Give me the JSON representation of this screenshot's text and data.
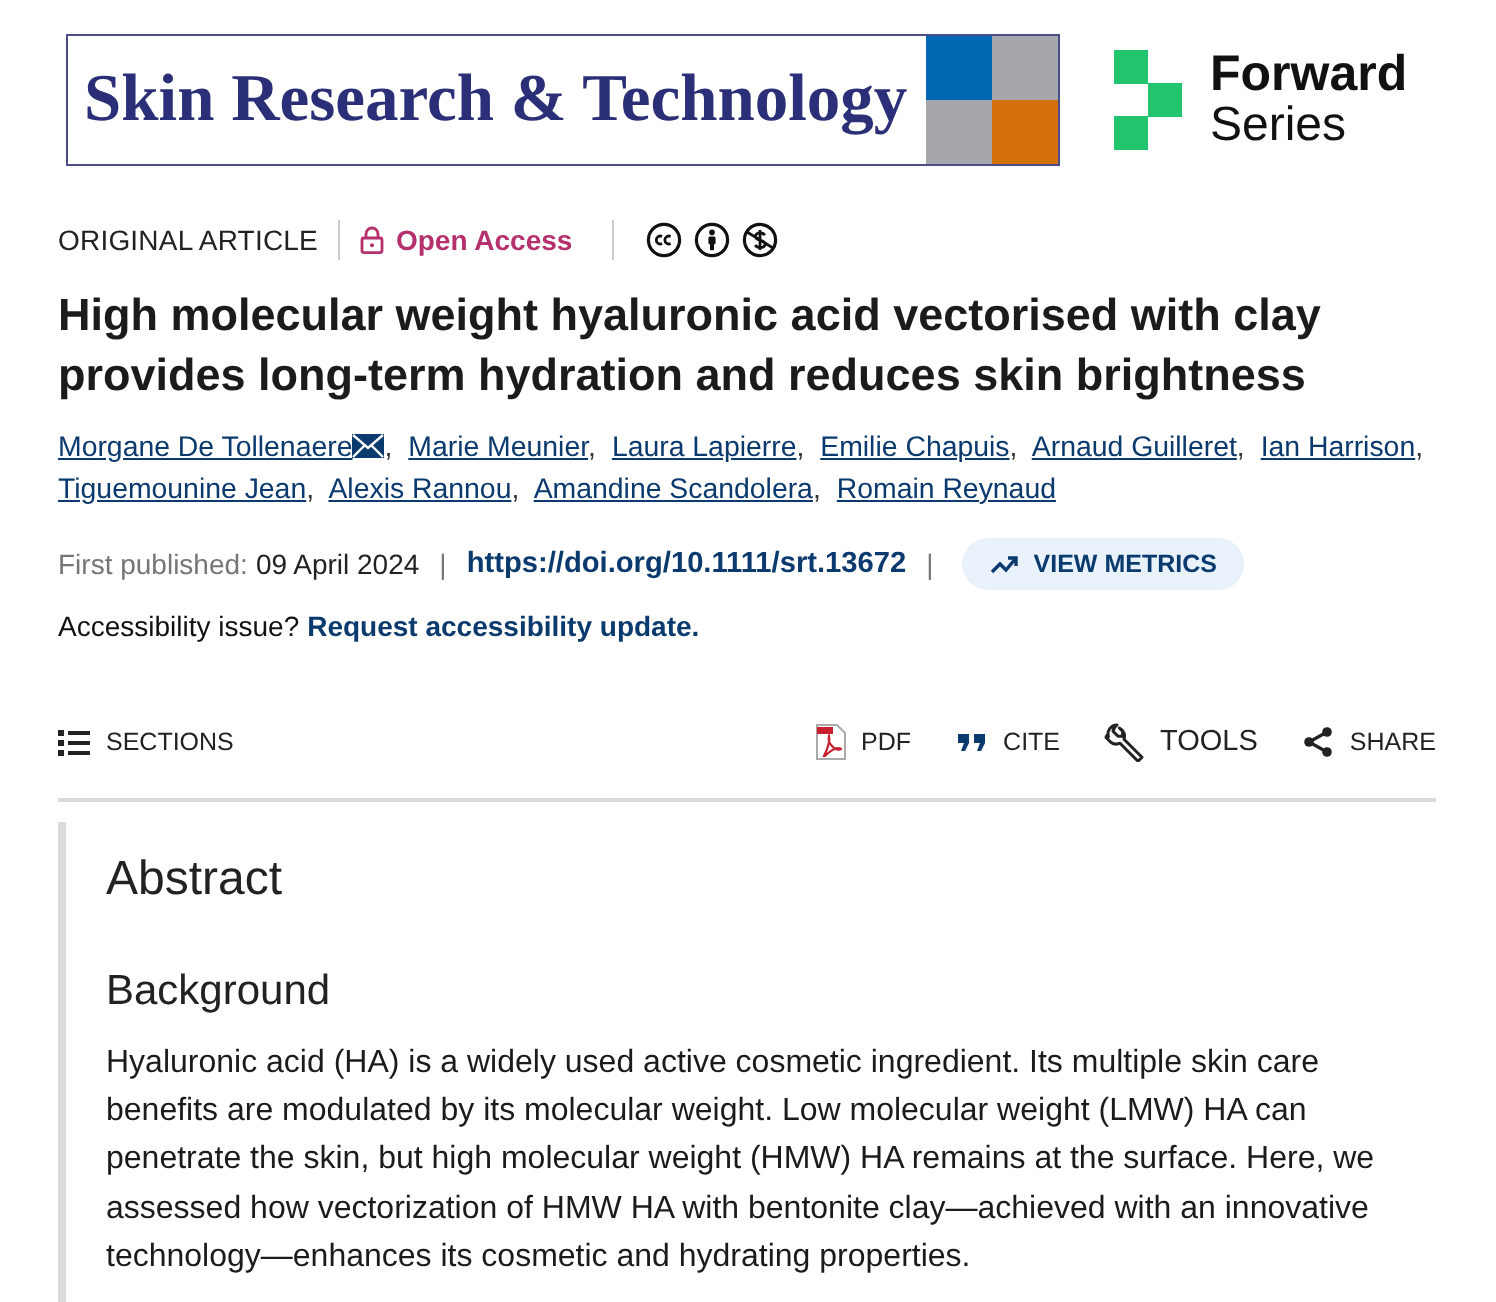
{
  "banner": {
    "journal_title": "Skin Research & Technology",
    "series_title": "Forward",
    "series_subtitle": "Series"
  },
  "article_meta": {
    "type": "ORIGINAL ARTICLE",
    "access": "Open Access"
  },
  "title": "High molecular weight hyaluronic acid vectorised with clay provides long-term hydration and reduces skin brightness",
  "authors": {
    "separator": ",",
    "items": [
      {
        "name": "Morgane De Tollenaere",
        "corresponding": true
      },
      {
        "name": "Marie Meunier",
        "corresponding": false
      },
      {
        "name": "Laura Lapierre",
        "corresponding": false
      },
      {
        "name": "Emilie Chapuis",
        "corresponding": false
      },
      {
        "name": "Arnaud Guilleret",
        "corresponding": false
      },
      {
        "name": "Ian Harrison",
        "corresponding": false
      },
      {
        "name": "Tiguemounine Jean",
        "corresponding": false
      },
      {
        "name": "Alexis Rannou",
        "corresponding": false
      },
      {
        "name": "Amandine Scandolera",
        "corresponding": false
      },
      {
        "name": "Romain Reynaud",
        "corresponding": false
      }
    ]
  },
  "publication": {
    "label": "First published:",
    "date": "09 April 2024",
    "separator": "|",
    "doi": "https://doi.org/10.1111/srt.13672",
    "metrics_button": "VIEW METRICS"
  },
  "accessibility": {
    "question": "Accessibility issue?",
    "link": "Request accessibility update."
  },
  "toolbar": {
    "sections": "SECTIONS",
    "actions": [
      {
        "kind": "pdf",
        "label": "PDF"
      },
      {
        "kind": "cite",
        "label": "CITE"
      },
      {
        "kind": "tools",
        "label": "TOOLS"
      },
      {
        "kind": "share",
        "label": "SHARE"
      }
    ]
  },
  "abstract": {
    "heading": "Abstract",
    "sections": [
      {
        "heading": "Background",
        "text": "Hyaluronic acid (HA) is a widely used active cosmetic ingredient. Its multiple skin care benefits are modulated by its molecular weight. Low molecular weight (LMW) HA can penetrate the skin, but high molecular weight (HMW) HA remains at the surface. Here, we assessed how vectorization of HMW HA with bentonite clay—achieved with an innovative technology—enhances its cosmetic and hydrating properties."
      }
    ]
  }
}
